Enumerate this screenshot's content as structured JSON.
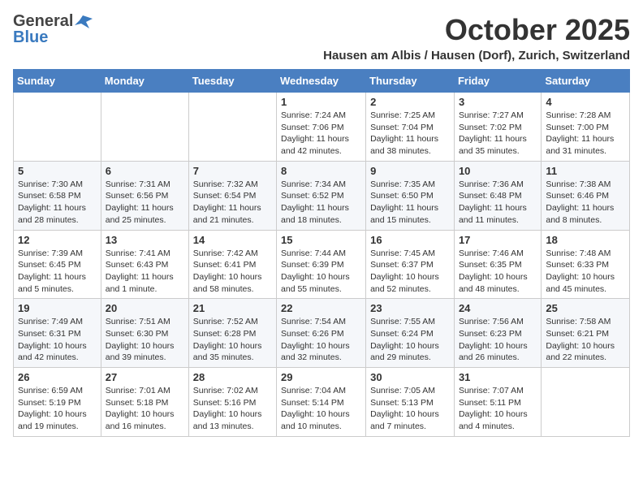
{
  "header": {
    "logo_general": "General",
    "logo_blue": "Blue",
    "month": "October 2025",
    "location": "Hausen am Albis / Hausen (Dorf), Zurich, Switzerland"
  },
  "days_of_week": [
    "Sunday",
    "Monday",
    "Tuesday",
    "Wednesday",
    "Thursday",
    "Friday",
    "Saturday"
  ],
  "weeks": [
    [
      {
        "day": "",
        "info": ""
      },
      {
        "day": "",
        "info": ""
      },
      {
        "day": "",
        "info": ""
      },
      {
        "day": "1",
        "info": "Sunrise: 7:24 AM\nSunset: 7:06 PM\nDaylight: 11 hours and 42 minutes."
      },
      {
        "day": "2",
        "info": "Sunrise: 7:25 AM\nSunset: 7:04 PM\nDaylight: 11 hours and 38 minutes."
      },
      {
        "day": "3",
        "info": "Sunrise: 7:27 AM\nSunset: 7:02 PM\nDaylight: 11 hours and 35 minutes."
      },
      {
        "day": "4",
        "info": "Sunrise: 7:28 AM\nSunset: 7:00 PM\nDaylight: 11 hours and 31 minutes."
      }
    ],
    [
      {
        "day": "5",
        "info": "Sunrise: 7:30 AM\nSunset: 6:58 PM\nDaylight: 11 hours and 28 minutes."
      },
      {
        "day": "6",
        "info": "Sunrise: 7:31 AM\nSunset: 6:56 PM\nDaylight: 11 hours and 25 minutes."
      },
      {
        "day": "7",
        "info": "Sunrise: 7:32 AM\nSunset: 6:54 PM\nDaylight: 11 hours and 21 minutes."
      },
      {
        "day": "8",
        "info": "Sunrise: 7:34 AM\nSunset: 6:52 PM\nDaylight: 11 hours and 18 minutes."
      },
      {
        "day": "9",
        "info": "Sunrise: 7:35 AM\nSunset: 6:50 PM\nDaylight: 11 hours and 15 minutes."
      },
      {
        "day": "10",
        "info": "Sunrise: 7:36 AM\nSunset: 6:48 PM\nDaylight: 11 hours and 11 minutes."
      },
      {
        "day": "11",
        "info": "Sunrise: 7:38 AM\nSunset: 6:46 PM\nDaylight: 11 hours and 8 minutes."
      }
    ],
    [
      {
        "day": "12",
        "info": "Sunrise: 7:39 AM\nSunset: 6:45 PM\nDaylight: 11 hours and 5 minutes."
      },
      {
        "day": "13",
        "info": "Sunrise: 7:41 AM\nSunset: 6:43 PM\nDaylight: 11 hours and 1 minute."
      },
      {
        "day": "14",
        "info": "Sunrise: 7:42 AM\nSunset: 6:41 PM\nDaylight: 10 hours and 58 minutes."
      },
      {
        "day": "15",
        "info": "Sunrise: 7:44 AM\nSunset: 6:39 PM\nDaylight: 10 hours and 55 minutes."
      },
      {
        "day": "16",
        "info": "Sunrise: 7:45 AM\nSunset: 6:37 PM\nDaylight: 10 hours and 52 minutes."
      },
      {
        "day": "17",
        "info": "Sunrise: 7:46 AM\nSunset: 6:35 PM\nDaylight: 10 hours and 48 minutes."
      },
      {
        "day": "18",
        "info": "Sunrise: 7:48 AM\nSunset: 6:33 PM\nDaylight: 10 hours and 45 minutes."
      }
    ],
    [
      {
        "day": "19",
        "info": "Sunrise: 7:49 AM\nSunset: 6:31 PM\nDaylight: 10 hours and 42 minutes."
      },
      {
        "day": "20",
        "info": "Sunrise: 7:51 AM\nSunset: 6:30 PM\nDaylight: 10 hours and 39 minutes."
      },
      {
        "day": "21",
        "info": "Sunrise: 7:52 AM\nSunset: 6:28 PM\nDaylight: 10 hours and 35 minutes."
      },
      {
        "day": "22",
        "info": "Sunrise: 7:54 AM\nSunset: 6:26 PM\nDaylight: 10 hours and 32 minutes."
      },
      {
        "day": "23",
        "info": "Sunrise: 7:55 AM\nSunset: 6:24 PM\nDaylight: 10 hours and 29 minutes."
      },
      {
        "day": "24",
        "info": "Sunrise: 7:56 AM\nSunset: 6:23 PM\nDaylight: 10 hours and 26 minutes."
      },
      {
        "day": "25",
        "info": "Sunrise: 7:58 AM\nSunset: 6:21 PM\nDaylight: 10 hours and 22 minutes."
      }
    ],
    [
      {
        "day": "26",
        "info": "Sunrise: 6:59 AM\nSunset: 5:19 PM\nDaylight: 10 hours and 19 minutes."
      },
      {
        "day": "27",
        "info": "Sunrise: 7:01 AM\nSunset: 5:18 PM\nDaylight: 10 hours and 16 minutes."
      },
      {
        "day": "28",
        "info": "Sunrise: 7:02 AM\nSunset: 5:16 PM\nDaylight: 10 hours and 13 minutes."
      },
      {
        "day": "29",
        "info": "Sunrise: 7:04 AM\nSunset: 5:14 PM\nDaylight: 10 hours and 10 minutes."
      },
      {
        "day": "30",
        "info": "Sunrise: 7:05 AM\nSunset: 5:13 PM\nDaylight: 10 hours and 7 minutes."
      },
      {
        "day": "31",
        "info": "Sunrise: 7:07 AM\nSunset: 5:11 PM\nDaylight: 10 hours and 4 minutes."
      },
      {
        "day": "",
        "info": ""
      }
    ]
  ]
}
